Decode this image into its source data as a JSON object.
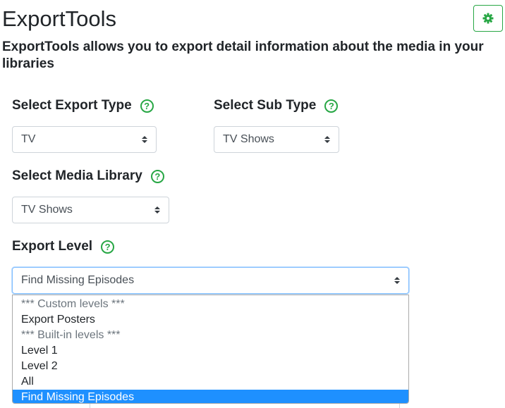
{
  "app": {
    "title": "ExportTools",
    "description": "ExportTools allows you to export detail information about the media in your libraries"
  },
  "help_glyph": "?",
  "settings": {
    "icon": "gear-icon"
  },
  "export_type": {
    "label": "Select Export Type",
    "value": "TV"
  },
  "sub_type": {
    "label": "Select Sub Type",
    "value": "TV Shows"
  },
  "media_library": {
    "label": "Select Media Library",
    "value": "TV Shows"
  },
  "export_level": {
    "label": "Export Level",
    "value": "Find Missing Episodes",
    "options": [
      {
        "label": "*** Custom levels ***",
        "group": true
      },
      {
        "label": "Export Posters"
      },
      {
        "label": "*** Built-in levels ***",
        "group": true
      },
      {
        "label": "Level 1"
      },
      {
        "label": "Level 2"
      },
      {
        "label": "All"
      },
      {
        "label": "Find Missing Episodes",
        "selected": true
      }
    ]
  },
  "colors": {
    "accent": "#28a745",
    "highlight": "#1e90ff",
    "focus": "#80bdff"
  }
}
